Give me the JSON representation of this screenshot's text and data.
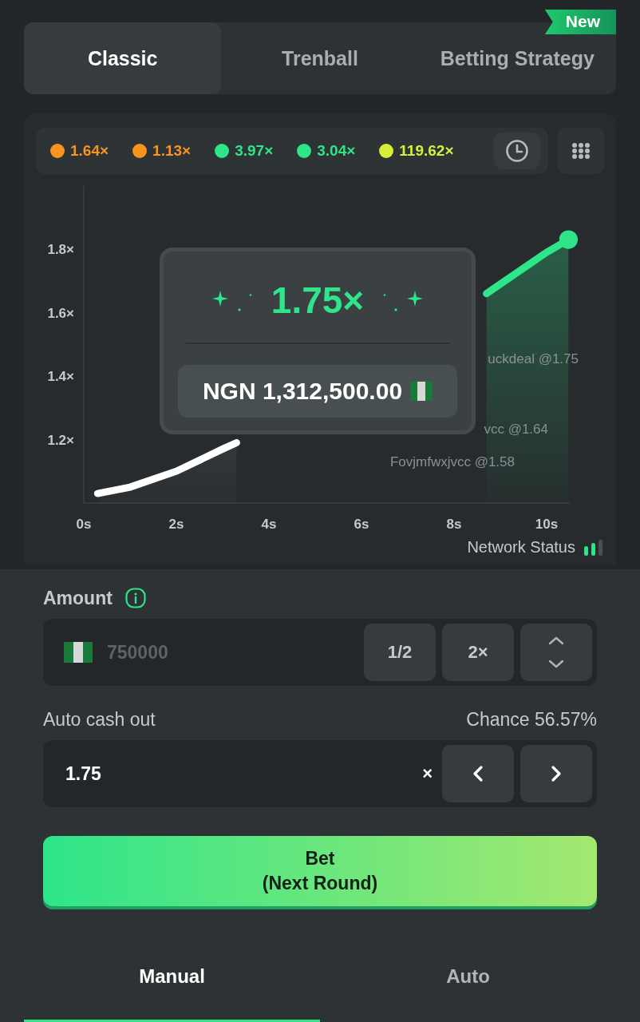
{
  "tabs": [
    {
      "label": "Classic",
      "selected": true
    },
    {
      "label": "Trenball",
      "selected": false
    },
    {
      "label": "Betting Strategy",
      "selected": false,
      "badge": "New"
    }
  ],
  "history": [
    {
      "value": "1.64×",
      "color": "#f7931e"
    },
    {
      "value": "1.13×",
      "color": "#f7931e"
    },
    {
      "value": "3.97×",
      "color": "#2ee58a"
    },
    {
      "value": "3.04×",
      "color": "#2ee58a"
    },
    {
      "value": "119.62×",
      "color": "#d7ee3b"
    }
  ],
  "chart": {
    "multiplier": "1.75×",
    "payout": "NGN 1,312,500.00",
    "players": [
      {
        "name": "uckdeal @1.75"
      },
      {
        "name": "vcc @1.64"
      },
      {
        "name": "Fovjmfwxjvcc @1.58"
      }
    ],
    "chart_data": {
      "type": "area",
      "x": [
        0.3,
        1,
        2,
        3,
        3.3,
        8.7,
        9,
        10,
        10.47
      ],
      "series": [
        {
          "color": "#ffffff",
          "values": [
            1.03,
            1.05,
            1.1,
            1.17,
            1.19,
            null,
            null,
            null,
            null
          ]
        },
        {
          "color": "#2ee58a",
          "values": [
            null,
            null,
            null,
            null,
            null,
            1.66,
            1.69,
            1.79,
            1.83
          ]
        }
      ],
      "xlim": [
        0,
        10.5
      ],
      "ylim": [
        1,
        2
      ],
      "xticks": [
        {
          "value": 0,
          "label": "0s"
        },
        {
          "value": 2,
          "label": "2s"
        },
        {
          "value": 4,
          "label": "4s"
        },
        {
          "value": 6,
          "label": "6s"
        },
        {
          "value": 8,
          "label": "8s"
        },
        {
          "value": 10,
          "label": "10s"
        }
      ],
      "yticks": [
        {
          "value": 1.2,
          "label": "1.2×"
        },
        {
          "value": 1.4,
          "label": "1.4×"
        },
        {
          "value": 1.6,
          "label": "1.6×"
        },
        {
          "value": 1.8,
          "label": "1.8×"
        }
      ]
    }
  },
  "network_status": "Network Status",
  "amount": {
    "label": "Amount",
    "placeholder": "750000",
    "buttons": [
      "1/2",
      "2×"
    ]
  },
  "auto_cash_out": {
    "label": "Auto cash out",
    "chance": "Chance 56.57%",
    "value": "1.75",
    "suffix": "×"
  },
  "bet": {
    "line1": "Bet",
    "line2": "(Next Round)"
  },
  "mode_tabs": [
    {
      "label": "Manual",
      "selected": true
    },
    {
      "label": "Auto",
      "selected": false
    }
  ]
}
